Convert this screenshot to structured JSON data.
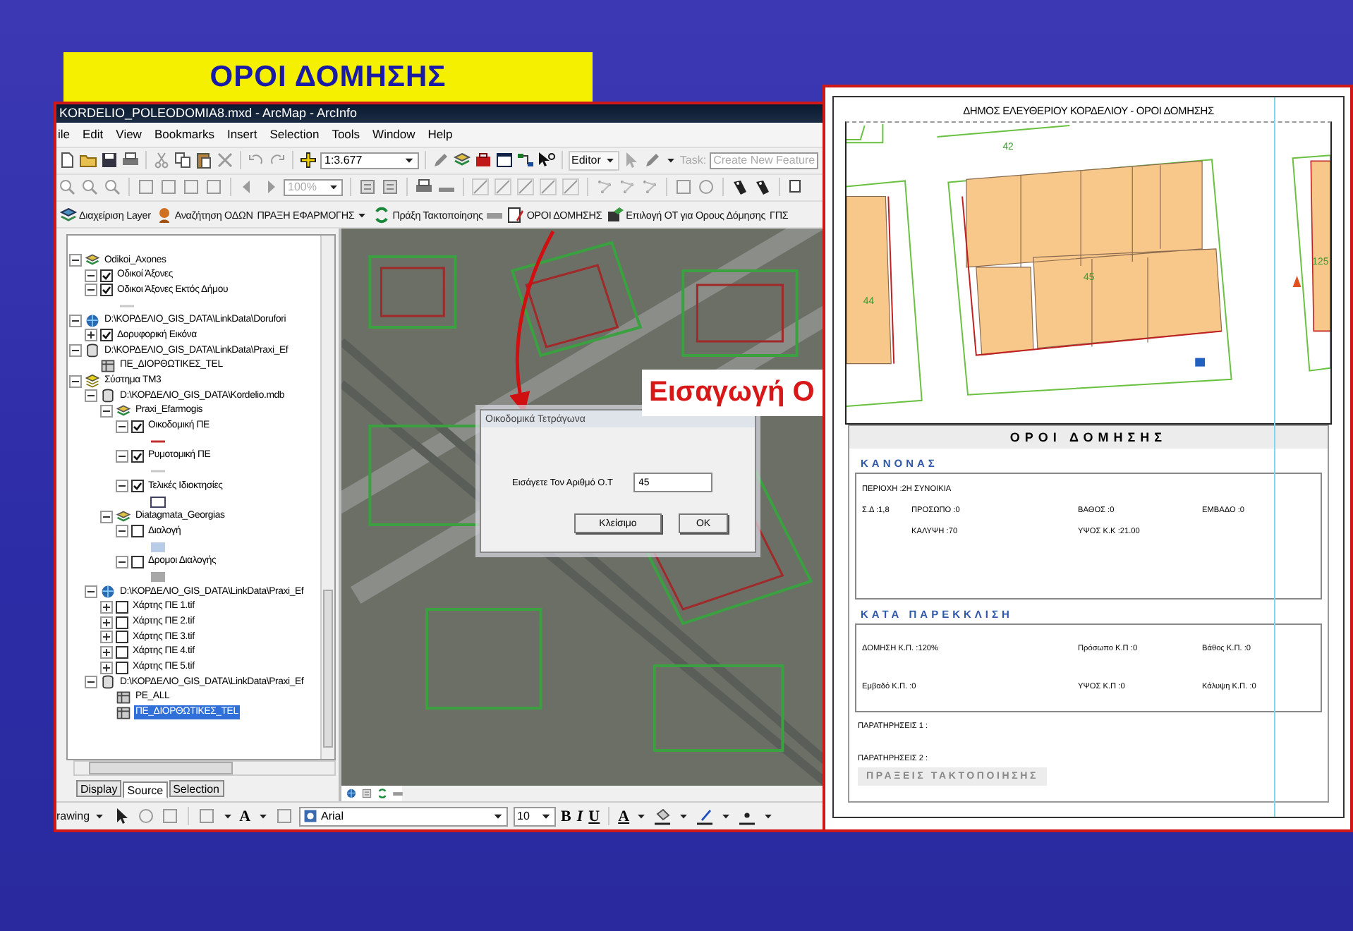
{
  "slide_title": "ΟΡΟΙ ΔΟΜΗΣΗΣ",
  "arcmap": {
    "title": "KORDELIO_POLEODOMIA8.mxd - ArcMap - ArcInfo",
    "menu": [
      "ile",
      "Edit",
      "View",
      "Bookmarks",
      "Insert",
      "Selection",
      "Tools",
      "Window",
      "Help"
    ],
    "standard_toolbar": {
      "scale": "1:3.677",
      "editor": "Editor",
      "task_label": "Task:",
      "task": "Create New Feature"
    },
    "tools_toolbar": {
      "zoom": "100%"
    },
    "custom_toolbar": [
      {
        "kind": "layers",
        "label": "Διαχείριση Layer"
      },
      {
        "kind": "search",
        "label": "Αναζήτηση ΟΔΩΝ"
      },
      {
        "kind": "menu",
        "label": "ΠΡΑΞΗ ΕΦΑΡΜΟΓΗΣ"
      },
      {
        "kind": "action",
        "label": "Πράξη Τακτοποίησης"
      },
      {
        "kind": "report",
        "label": "ΟΡΟΙ ΔΟΜΗΣΗΣ"
      },
      {
        "kind": "select",
        "label": "Επιλογή ΟΤ για Ορους Δόμησης"
      },
      {
        "kind": "plain",
        "label": "ΓΠΣ"
      }
    ],
    "toc": [
      {
        "kind": "group",
        "label": "Odikoi_Axones",
        "expanded": true,
        "selected": false,
        "children": [
          {
            "label": "Οδικοί Άξονες",
            "expanded": true,
            "checked": true,
            "selected": false
          },
          {
            "label": "Οδικοι Άξονες Εκτός Δήμου",
            "expanded": true,
            "checked": true,
            "selected": false,
            "legend": {
              "kind": "line",
              "color": "#c8c8c8"
            }
          }
        ]
      },
      {
        "kind": "raster",
        "label": "D:\\ΚΟΡΔΕΛΙΟ_GIS_DATA\\LinkData\\Dorufori",
        "expanded": true,
        "selected": false,
        "children": [
          {
            "label": "Δορυφορική Εικόνα",
            "expanded": false,
            "checked": true,
            "selected": false
          }
        ]
      },
      {
        "kind": "database",
        "label": "D:\\ΚΟΡΔΕΛΙΟ_GIS_DATA\\LinkData\\Praxi_Ef",
        "expanded": true,
        "selected": false,
        "children": [
          {
            "kind": "table",
            "label": "ΠΕ_ΔΙΟΡΘΩΤΙΚΕΣ_TEL",
            "selected": false
          }
        ]
      },
      {
        "kind": "dataframe",
        "label": "Σύστημα ΤΜ3",
        "expanded": true,
        "selected": false,
        "children": [
          {
            "kind": "database",
            "label": "D:\\ΚΟΡΔΕΛΙΟ_GIS_DATA\\Kordelio.mdb",
            "expanded": true,
            "selected": false,
            "children": [
              {
                "kind": "group",
                "label": "Praxi_Efarmogis",
                "expanded": true,
                "selected": false,
                "children": [
                  {
                    "label": "Οικοδομική ΠΕ",
                    "expanded": true,
                    "checked": true,
                    "selected": false,
                    "legend": {
                      "kind": "line",
                      "color": "#c03030"
                    }
                  },
                  {
                    "label": "Ρυμοτομική ΠΕ",
                    "expanded": true,
                    "checked": true,
                    "selected": false,
                    "legend": {
                      "kind": "line",
                      "color": "#c8c8c8"
                    }
                  },
                  {
                    "label": "Τελικές Ιδιοκτησίες",
                    "expanded": true,
                    "checked": true,
                    "selected": false,
                    "legend": {
                      "kind": "outline",
                      "color": "#404060"
                    }
                  }
                ]
              },
              {
                "kind": "group",
                "label": "Diatagmata_Georgias",
                "expanded": true,
                "selected": false,
                "children": [
                  {
                    "label": "Διαλογή",
                    "expanded": true,
                    "checked": false,
                    "selected": false,
                    "legend": {
                      "kind": "fill",
                      "color": "#b8cce8"
                    }
                  },
                  {
                    "label": "Δρομοι Διαλογής",
                    "expanded": true,
                    "checked": false,
                    "selected": false,
                    "legend": {
                      "kind": "fill",
                      "color": "#a8a8a8"
                    }
                  }
                ]
              }
            ]
          },
          {
            "kind": "raster",
            "label": "D:\\ΚΟΡΔΕΛΙΟ_GIS_DATA\\LinkData\\Praxi_Ef",
            "expanded": true,
            "selected": false,
            "children": [
              {
                "label": "Χάρτης ΠΕ 1.tif",
                "expanded": false,
                "checked": false,
                "selected": false
              },
              {
                "label": "Χάρτης ΠΕ 2.tif",
                "expanded": false,
                "checked": false,
                "selected": false
              },
              {
                "label": "Χάρτης ΠΕ 3.tif",
                "expanded": false,
                "checked": false,
                "selected": false
              },
              {
                "label": "Χάρτης ΠΕ 4.tif",
                "expanded": false,
                "checked": false,
                "selected": false
              },
              {
                "label": "Χάρτης ΠΕ 5.tif",
                "expanded": false,
                "checked": false,
                "selected": false
              }
            ]
          },
          {
            "kind": "database",
            "label": "D:\\ΚΟΡΔΕΛΙΟ_GIS_DATA\\LinkData\\Praxi_Ef",
            "expanded": true,
            "selected": false,
            "children": [
              {
                "kind": "table",
                "label": "PE_ALL",
                "selected": false
              },
              {
                "kind": "table",
                "label": "ΠΕ_ΔΙΟΡΘΩΤΙΚΕΣ_TEL",
                "selected": true
              }
            ]
          }
        ]
      }
    ],
    "toc_tabs": [
      {
        "label": "Display",
        "selected": false
      },
      {
        "label": "Source",
        "selected": true
      },
      {
        "label": "Selection",
        "selected": false
      }
    ],
    "dialog": {
      "title": "Οικοδομικά Τετράγωνα",
      "label": "Εισάγετε Τον Αριθμό Ο.Τ",
      "value": "45",
      "buttons": [
        "Κλείσιμο",
        "ΟΚ"
      ]
    },
    "drawing_toolbar": {
      "label": "rawing",
      "text_tool": "A",
      "font": "Arial",
      "size": "10",
      "styles": [
        "B",
        "I",
        "U"
      ],
      "font_color": "A"
    }
  },
  "callout": "Εισαγωγή Ο",
  "report": {
    "header": "ΔΗΜΟΣ ΕΛΕΥΘΕΡΙΟΥ ΚΟΡΔΕΛΙΟΥ - ΟΡΟΙ ΔΟΜΗΣΗΣ",
    "map_labels": [
      "42",
      "44",
      "45",
      "125"
    ],
    "title": "ΟΡΟΙ ΔΟΜΗΣΗΣ",
    "sections": [
      {
        "heading": "ΚΑΝΟΝΑΣ",
        "kind": "four-column",
        "lead": "ΠΕΡΙΟΧΗ :2Η ΣΥΝΟΙΚΙΑ",
        "rows": [
          [
            "Σ.Δ :1,8",
            "ΠΡΟΣΩΠΟ :0",
            "ΒΑΘΟΣ :0",
            "ΕΜΒΑΔΟ :0"
          ],
          [
            "",
            "ΚΑΛΥΨΗ :70",
            "ΥΨΟΣ Κ.Κ :21.00"
          ]
        ]
      },
      {
        "heading": "ΚΑΤΑ ΠΑΡΕΚΚΛΙΣΗ",
        "kind": "three-column",
        "rows": [
          [
            "ΔΟΜΗΣΗ Κ.Π. :120%",
            "Πρόσωπο Κ.Π :0",
            "Βάθος Κ.Π. :0"
          ],
          [
            "Εμβαδό Κ.Π. :0",
            "ΥΨΟΣ Κ.Π :0",
            "Κάλυψη Κ.Π. :0"
          ]
        ]
      }
    ],
    "remarks": [
      "ΠΑΡΑΤΗΡΗΣΕΙΣ 1 :",
      "ΠΑΡΑΤΗΡΗΣΕΙΣ 2 :"
    ],
    "footer": "ΠΡΑΞΕΙΣ ΤΑΚΤΟΠΟΙΗΣΗΣ"
  }
}
